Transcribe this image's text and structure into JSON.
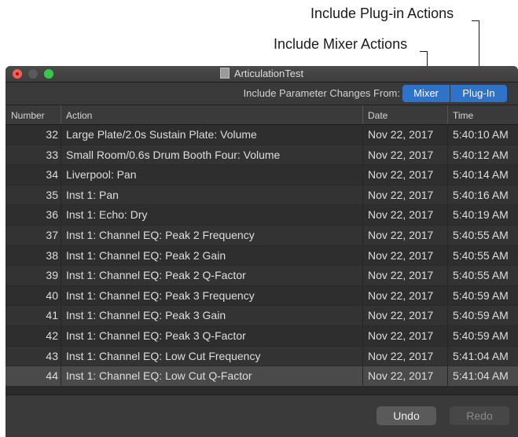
{
  "callouts": {
    "plugin": "Include Plug-in Actions",
    "mixer": "Include Mixer Actions"
  },
  "window": {
    "title": "ArticulationTest"
  },
  "toolbar": {
    "label": "Include Parameter Changes From:",
    "mixer": "Mixer",
    "plugin": "Plug-In"
  },
  "columns": {
    "number": "Number",
    "action": "Action",
    "date": "Date",
    "time": "Time"
  },
  "rows": [
    {
      "number": "32",
      "action": "Large Plate/2.0s Sustain Plate: Volume",
      "date": "Nov 22, 2017",
      "time": "5:40:10 AM"
    },
    {
      "number": "33",
      "action": "Small Room/0.6s Drum Booth Four: Volume",
      "date": "Nov 22, 2017",
      "time": "5:40:12 AM"
    },
    {
      "number": "34",
      "action": "Liverpool: Pan",
      "date": "Nov 22, 2017",
      "time": "5:40:14 AM"
    },
    {
      "number": "35",
      "action": "Inst 1: Pan",
      "date": "Nov 22, 2017",
      "time": "5:40:16 AM"
    },
    {
      "number": "36",
      "action": "Inst 1: Echo: Dry",
      "date": "Nov 22, 2017",
      "time": "5:40:19 AM"
    },
    {
      "number": "37",
      "action": "Inst 1: Channel EQ: Peak 2 Frequency",
      "date": "Nov 22, 2017",
      "time": "5:40:55 AM"
    },
    {
      "number": "38",
      "action": "Inst 1: Channel EQ: Peak 2 Gain",
      "date": "Nov 22, 2017",
      "time": "5:40:55 AM"
    },
    {
      "number": "39",
      "action": "Inst 1: Channel EQ: Peak 2 Q-Factor",
      "date": "Nov 22, 2017",
      "time": "5:40:55 AM"
    },
    {
      "number": "40",
      "action": "Inst 1: Channel EQ: Peak 3 Frequency",
      "date": "Nov 22, 2017",
      "time": "5:40:59 AM"
    },
    {
      "number": "41",
      "action": "Inst 1: Channel EQ: Peak 3 Gain",
      "date": "Nov 22, 2017",
      "time": "5:40:59 AM"
    },
    {
      "number": "42",
      "action": "Inst 1: Channel EQ: Peak 3 Q-Factor",
      "date": "Nov 22, 2017",
      "time": "5:40:59 AM"
    },
    {
      "number": "43",
      "action": "Inst 1: Channel EQ: Low Cut Frequency",
      "date": "Nov 22, 2017",
      "time": "5:41:04 AM"
    },
    {
      "number": "44",
      "action": "Inst 1: Channel EQ: Low Cut Q-Factor",
      "date": "Nov 22, 2017",
      "time": "5:41:04 AM"
    }
  ],
  "footer": {
    "undo": "Undo",
    "redo": "Redo"
  }
}
